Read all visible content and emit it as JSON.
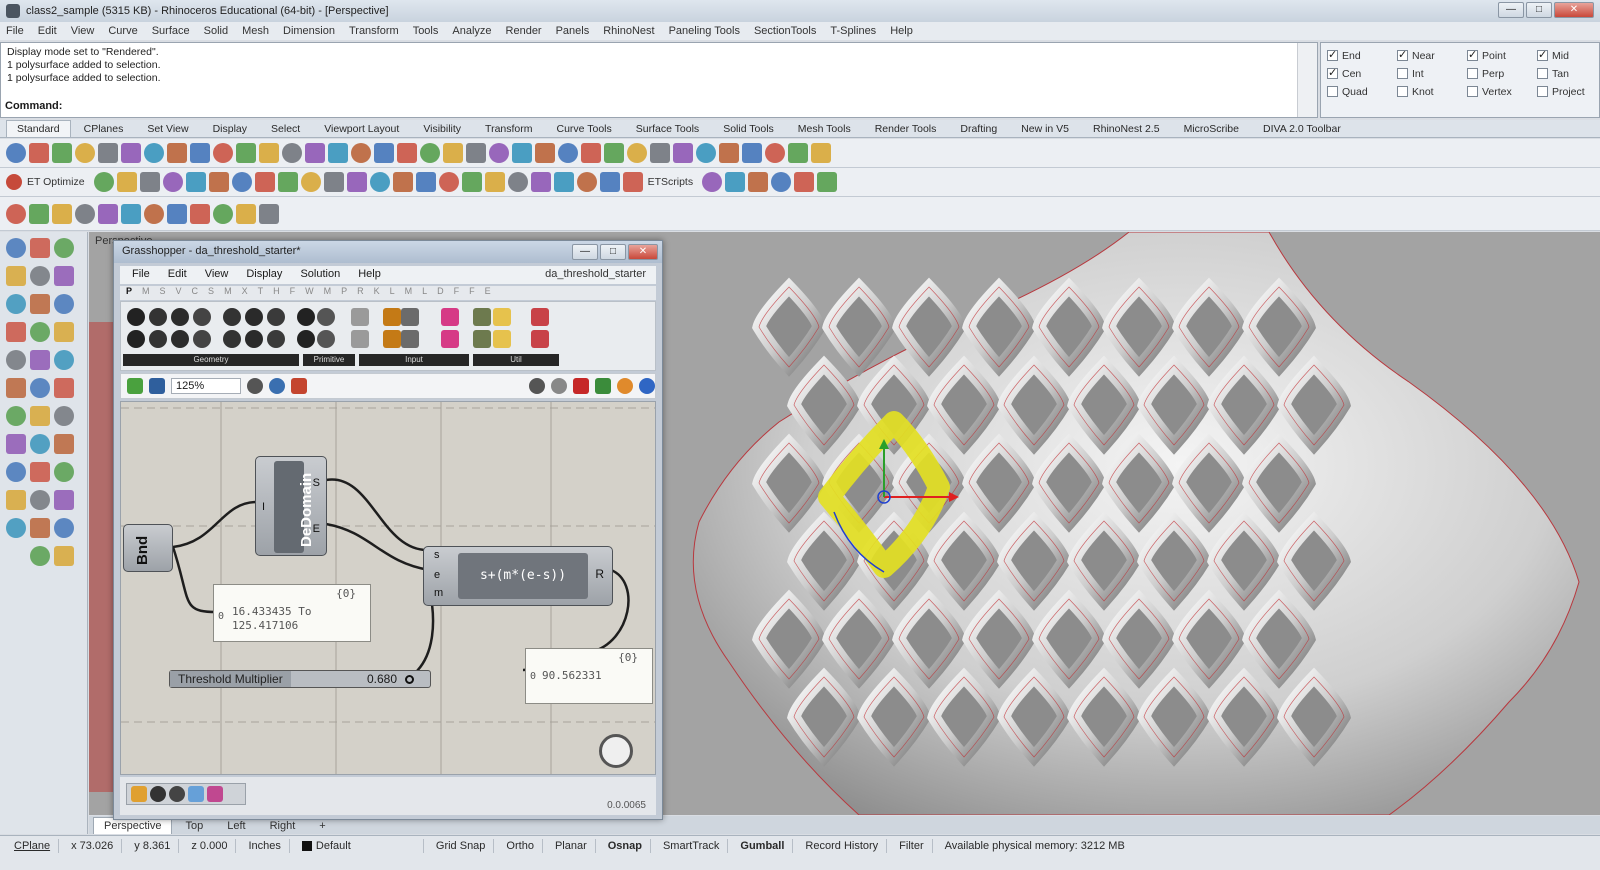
{
  "window": {
    "title": "class2_sample (5315 KB) - Rhinoceros Educational (64-bit) - [Perspective]",
    "buttons": {
      "minimize": "—",
      "maximize": "□",
      "close": "✕"
    }
  },
  "menubar": [
    "File",
    "Edit",
    "View",
    "Curve",
    "Surface",
    "Solid",
    "Mesh",
    "Dimension",
    "Transform",
    "Tools",
    "Analyze",
    "Render",
    "Panels",
    "RhinoNest",
    "Paneling Tools",
    "SectionTools",
    "T-Splines",
    "Help"
  ],
  "command": {
    "history": [
      "Display mode set to \"Rendered\".",
      "1 polysurface added to selection.",
      "1 polysurface added to selection."
    ],
    "prompt": "Command:"
  },
  "osnap": [
    {
      "label": "End",
      "checked": true
    },
    {
      "label": "Near",
      "checked": true
    },
    {
      "label": "Point",
      "checked": true
    },
    {
      "label": "Mid",
      "checked": true
    },
    {
      "label": "Cen",
      "checked": true
    },
    {
      "label": "Int",
      "checked": false
    },
    {
      "label": "Perp",
      "checked": false
    },
    {
      "label": "Tan",
      "checked": false
    },
    {
      "label": "Quad",
      "checked": false
    },
    {
      "label": "Knot",
      "checked": false
    },
    {
      "label": "Vertex",
      "checked": false
    },
    {
      "label": "Project",
      "checked": false
    }
  ],
  "toolbar_tabs": [
    "Standard",
    "CPlanes",
    "Set View",
    "Display",
    "Select",
    "Viewport Layout",
    "Visibility",
    "Transform",
    "Curve Tools",
    "Surface Tools",
    "Solid Tools",
    "Mesh Tools",
    "Render Tools",
    "Drafting",
    "New in V5",
    "RhinoNest 2.5",
    "MicroScribe",
    "DIVA 2.0 Toolbar"
  ],
  "toolbar_labels": {
    "et_optimize": "ET Optimize",
    "et_scripts": "ETScripts"
  },
  "grasshopper": {
    "title": "Grasshopper - da_threshold_starter*",
    "doc_name": "da_threshold_starter",
    "menu": [
      "File",
      "Edit",
      "View",
      "Display",
      "Solution",
      "Help"
    ],
    "categories": [
      "P",
      "M",
      "S",
      "V",
      "C",
      "S",
      "M",
      "X",
      "T",
      "H",
      "F",
      "W",
      "M",
      "P",
      "R",
      "K",
      "L",
      "M",
      "L",
      "D",
      "F",
      "F",
      "E"
    ],
    "ribbon_groups": [
      "Geometry",
      "Primitive",
      "Input",
      "Util"
    ],
    "zoom": "125%",
    "fps": "0.0.0065",
    "nodes": {
      "bnd": "Bnd",
      "dedomain": "DeDomain",
      "dedomain_in": "I",
      "dedomain_out_s": "S",
      "dedomain_out_e": "E",
      "expr_inputs": [
        "s",
        "e",
        "m"
      ],
      "expression": "s+(m*(e-s))",
      "expr_out": "R"
    },
    "panel1": {
      "header": "{0}",
      "index": "0",
      "text": "16.433435 To 125.417106"
    },
    "panel2": {
      "header": "{0}",
      "index": "0",
      "text": "90.562331"
    },
    "slider": {
      "label": "Threshold Multiplier",
      "value": "0.680"
    }
  },
  "viewport_tabs": [
    "Perspective",
    "Top",
    "Left",
    "Right"
  ],
  "statusbar": {
    "cplane": "CPlane",
    "x": "x 73.026",
    "y": "y 8.361",
    "z": "z 0.000",
    "units": "Inches",
    "layer": "Default",
    "grid_snap": "Grid Snap",
    "ortho": "Ortho",
    "planar": "Planar",
    "osnap": "Osnap",
    "smarttrack": "SmartTrack",
    "gumball": "Gumball",
    "record_history": "Record History",
    "filter": "Filter",
    "memory": "Available physical memory: 3212 MB"
  },
  "colors": {
    "accent": "#d8d000",
    "gumball_x": "#e02020",
    "gumball_y": "#2aa02a",
    "gumball_z": "#2040d0",
    "edge_red": "#c0282e"
  }
}
